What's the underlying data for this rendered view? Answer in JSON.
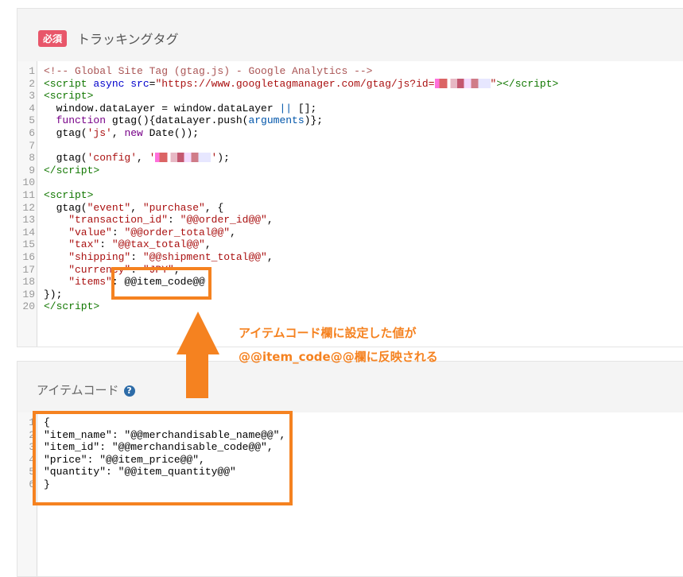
{
  "tracking": {
    "badge": "必須",
    "title": "トラッキングタグ",
    "lines": [
      [
        [
          "c-com",
          "<!-- Global Site Tag (gtag.js) - Google Analytics -->"
        ]
      ],
      [
        [
          "c-tag",
          "<script "
        ],
        [
          "c-attr",
          "async src"
        ],
        [
          "c-def",
          "="
        ],
        [
          "c-str",
          "\"https://www.googletagmanager.com/gtag/js?id="
        ],
        [
          "blur",
          ""
        ],
        [
          "c-str",
          "\""
        ],
        [
          "c-tag",
          "></script>"
        ]
      ],
      [
        [
          "c-tag",
          "<script>"
        ]
      ],
      [
        [
          "c-def",
          "  window.dataLayer = window.dataLayer "
        ],
        [
          "c-var",
          "||"
        ],
        [
          "c-def",
          " [];"
        ]
      ],
      [
        [
          "c-kw",
          "  function"
        ],
        [
          "c-def",
          " gtag(){dataLayer.push("
        ],
        [
          "c-var",
          "arguments"
        ],
        [
          "c-def",
          ")};"
        ]
      ],
      [
        [
          "c-def",
          "  gtag("
        ],
        [
          "c-str",
          "'js'"
        ],
        [
          "c-def",
          ", "
        ],
        [
          "c-kw",
          "new"
        ],
        [
          "c-def",
          " Date());"
        ]
      ],
      [
        [
          "c-def",
          ""
        ]
      ],
      [
        [
          "c-def",
          "  gtag("
        ],
        [
          "c-str",
          "'config'"
        ],
        [
          "c-def",
          ", "
        ],
        [
          "c-str",
          "'"
        ],
        [
          "blur",
          ""
        ],
        [
          "c-str",
          "'"
        ],
        [
          "c-def",
          ");"
        ]
      ],
      [
        [
          "c-tag",
          "</script>"
        ]
      ],
      [
        [
          "c-def",
          ""
        ]
      ],
      [
        [
          "c-tag",
          "<script>"
        ]
      ],
      [
        [
          "c-def",
          "  gtag("
        ],
        [
          "c-str",
          "\"event\""
        ],
        [
          "c-def",
          ", "
        ],
        [
          "c-str",
          "\"purchase\""
        ],
        [
          "c-def",
          ", {"
        ]
      ],
      [
        [
          "c-str",
          "    \"transaction_id\""
        ],
        [
          "c-def",
          ": "
        ],
        [
          "c-str",
          "\"@@order_id@@\""
        ],
        [
          "c-def",
          ","
        ]
      ],
      [
        [
          "c-str",
          "    \"value\""
        ],
        [
          "c-def",
          ": "
        ],
        [
          "c-str",
          "\"@@order_total@@\""
        ],
        [
          "c-def",
          ","
        ]
      ],
      [
        [
          "c-str",
          "    \"tax\""
        ],
        [
          "c-def",
          ": "
        ],
        [
          "c-str",
          "\"@@tax_total@@\""
        ],
        [
          "c-def",
          ","
        ]
      ],
      [
        [
          "c-str",
          "    \"shipping\""
        ],
        [
          "c-def",
          ": "
        ],
        [
          "c-str",
          "\"@@shipment_total@@\""
        ],
        [
          "c-def",
          ","
        ]
      ],
      [
        [
          "c-str",
          "    \"currency\""
        ],
        [
          "c-def",
          ": "
        ],
        [
          "c-str",
          "\"JPY\""
        ],
        [
          "c-def",
          ","
        ]
      ],
      [
        [
          "c-str",
          "    \"items\""
        ],
        [
          "c-def",
          ": @@item_code@@"
        ]
      ],
      [
        [
          "c-def",
          "});"
        ]
      ],
      [
        [
          "c-tag",
          "</script>"
        ]
      ]
    ]
  },
  "annotation": {
    "line1": "アイテムコード欄に設定した値が",
    "line2": "@@item_code@@欄に反映される"
  },
  "item_code": {
    "title": "アイテムコード",
    "help_icon": "?",
    "lines": [
      [
        [
          "c-def",
          "{"
        ]
      ],
      [
        [
          "c-def",
          "\"item_name\": \"@@merchandisable_name@@\","
        ]
      ],
      [
        [
          "c-def",
          "\"item_id\": \"@@merchandisable_code@@\","
        ]
      ],
      [
        [
          "c-def",
          "\"price\": \"@@item_price@@\","
        ]
      ],
      [
        [
          "c-def",
          "\"quantity\": \"@@item_quantity@@\""
        ]
      ],
      [
        [
          "c-def",
          "}"
        ]
      ]
    ]
  },
  "colors": {
    "accent": "#f58220",
    "badge": "#e8566a"
  }
}
